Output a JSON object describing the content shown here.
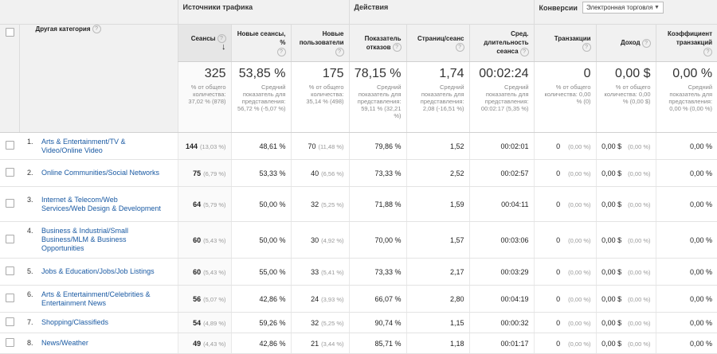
{
  "groups": {
    "traffic": "Источники трафика",
    "actions": "Действия",
    "conversions": "Конверсии",
    "ecommerce_select": "Электронная торговля"
  },
  "headers": {
    "dimension": "Другая категория",
    "sessions": "Сеансы",
    "new_sessions": "Новые сеансы, %",
    "new_users": "Новые пользователи",
    "bounce_rate": "Показатель отказов",
    "pages_session": "Страниц/сеанс",
    "avg_duration": "Сред. длительность сеанса",
    "transactions": "Транзакции",
    "revenue": "Доход",
    "conv_rate": "Коэффициент транзакций"
  },
  "totals": {
    "sessions": {
      "value": "325",
      "sub": "% от общего количества: 37,02 % (878)"
    },
    "new_sessions": {
      "value": "53,85 %",
      "sub": "Средний показатель для представления: 56,72 % (-5,07 %)"
    },
    "new_users": {
      "value": "175",
      "sub": "% от общего количества: 35,14 % (498)"
    },
    "bounce_rate": {
      "value": "78,15 %",
      "sub": "Средний показатель для представления: 59,11 % (32,21 %)"
    },
    "pages_session": {
      "value": "1,74",
      "sub": "Средний показатель для представления: 2,08 (-16,51 %)"
    },
    "avg_duration": {
      "value": "00:02:24",
      "sub": "Средний показатель для представления: 00:02:17 (5,35 %)"
    },
    "transactions": {
      "value": "0",
      "sub": "% от общего количества: 0,00 % (0)"
    },
    "revenue": {
      "value": "0,00 $",
      "sub": "% от общего количества: 0,00 % (0,00 $)"
    },
    "conv_rate": {
      "value": "0,00 %",
      "sub": "Средний показатель для представления: 0,00 % (0,00 %)"
    }
  },
  "rows": [
    {
      "idx": "1.",
      "name": "Arts & Entertainment/TV & Video/Online Video",
      "sessions": "144",
      "sessions_pct": "(13,03 %)",
      "new_sessions": "48,61 %",
      "new_users": "70",
      "new_users_pct": "(11,48 %)",
      "bounce": "79,86 %",
      "pages": "1,52",
      "duration": "00:02:01",
      "trans": "0",
      "trans_pct": "(0,00 %)",
      "revenue": "0,00 $",
      "revenue_pct": "(0,00 %)",
      "conv": "0,00 %"
    },
    {
      "idx": "2.",
      "name": "Online Communities/Social Networks",
      "sessions": "75",
      "sessions_pct": "(6,79 %)",
      "new_sessions": "53,33 %",
      "new_users": "40",
      "new_users_pct": "(6,56 %)",
      "bounce": "73,33 %",
      "pages": "2,52",
      "duration": "00:02:57",
      "trans": "0",
      "trans_pct": "(0,00 %)",
      "revenue": "0,00 $",
      "revenue_pct": "(0,00 %)",
      "conv": "0,00 %"
    },
    {
      "idx": "3.",
      "name": "Internet & Telecom/Web Services/Web Design & Development",
      "sessions": "64",
      "sessions_pct": "(5,79 %)",
      "new_sessions": "50,00 %",
      "new_users": "32",
      "new_users_pct": "(5,25 %)",
      "bounce": "71,88 %",
      "pages": "1,59",
      "duration": "00:04:11",
      "trans": "0",
      "trans_pct": "(0,00 %)",
      "revenue": "0,00 $",
      "revenue_pct": "(0,00 %)",
      "conv": "0,00 %"
    },
    {
      "idx": "4.",
      "name": "Business & Industrial/Small Business/MLM & Business Opportunities",
      "sessions": "60",
      "sessions_pct": "(5,43 %)",
      "new_sessions": "50,00 %",
      "new_users": "30",
      "new_users_pct": "(4,92 %)",
      "bounce": "70,00 %",
      "pages": "1,57",
      "duration": "00:03:06",
      "trans": "0",
      "trans_pct": "(0,00 %)",
      "revenue": "0,00 $",
      "revenue_pct": "(0,00 %)",
      "conv": "0,00 %"
    },
    {
      "idx": "5.",
      "name": "Jobs & Education/Jobs/Job Listings",
      "sessions": "60",
      "sessions_pct": "(5,43 %)",
      "new_sessions": "55,00 %",
      "new_users": "33",
      "new_users_pct": "(5,41 %)",
      "bounce": "73,33 %",
      "pages": "2,17",
      "duration": "00:03:29",
      "trans": "0",
      "trans_pct": "(0,00 %)",
      "revenue": "0,00 $",
      "revenue_pct": "(0,00 %)",
      "conv": "0,00 %"
    },
    {
      "idx": "6.",
      "name": "Arts & Entertainment/Celebrities & Entertainment News",
      "sessions": "56",
      "sessions_pct": "(5,07 %)",
      "new_sessions": "42,86 %",
      "new_users": "24",
      "new_users_pct": "(3,93 %)",
      "bounce": "66,07 %",
      "pages": "2,80",
      "duration": "00:04:19",
      "trans": "0",
      "trans_pct": "(0,00 %)",
      "revenue": "0,00 $",
      "revenue_pct": "(0,00 %)",
      "conv": "0,00 %"
    },
    {
      "idx": "7.",
      "name": "Shopping/Classifieds",
      "sessions": "54",
      "sessions_pct": "(4,89 %)",
      "new_sessions": "59,26 %",
      "new_users": "32",
      "new_users_pct": "(5,25 %)",
      "bounce": "90,74 %",
      "pages": "1,15",
      "duration": "00:00:32",
      "trans": "0",
      "trans_pct": "(0,00 %)",
      "revenue": "0,00 $",
      "revenue_pct": "(0,00 %)",
      "conv": "0,00 %"
    },
    {
      "idx": "8.",
      "name": "News/Weather",
      "sessions": "49",
      "sessions_pct": "(4,43 %)",
      "new_sessions": "42,86 %",
      "new_users": "21",
      "new_users_pct": "(3,44 %)",
      "bounce": "85,71 %",
      "pages": "1,18",
      "duration": "00:01:17",
      "trans": "0",
      "trans_pct": "(0,00 %)",
      "revenue": "0,00 $",
      "revenue_pct": "(0,00 %)",
      "conv": "0,00 %"
    }
  ]
}
